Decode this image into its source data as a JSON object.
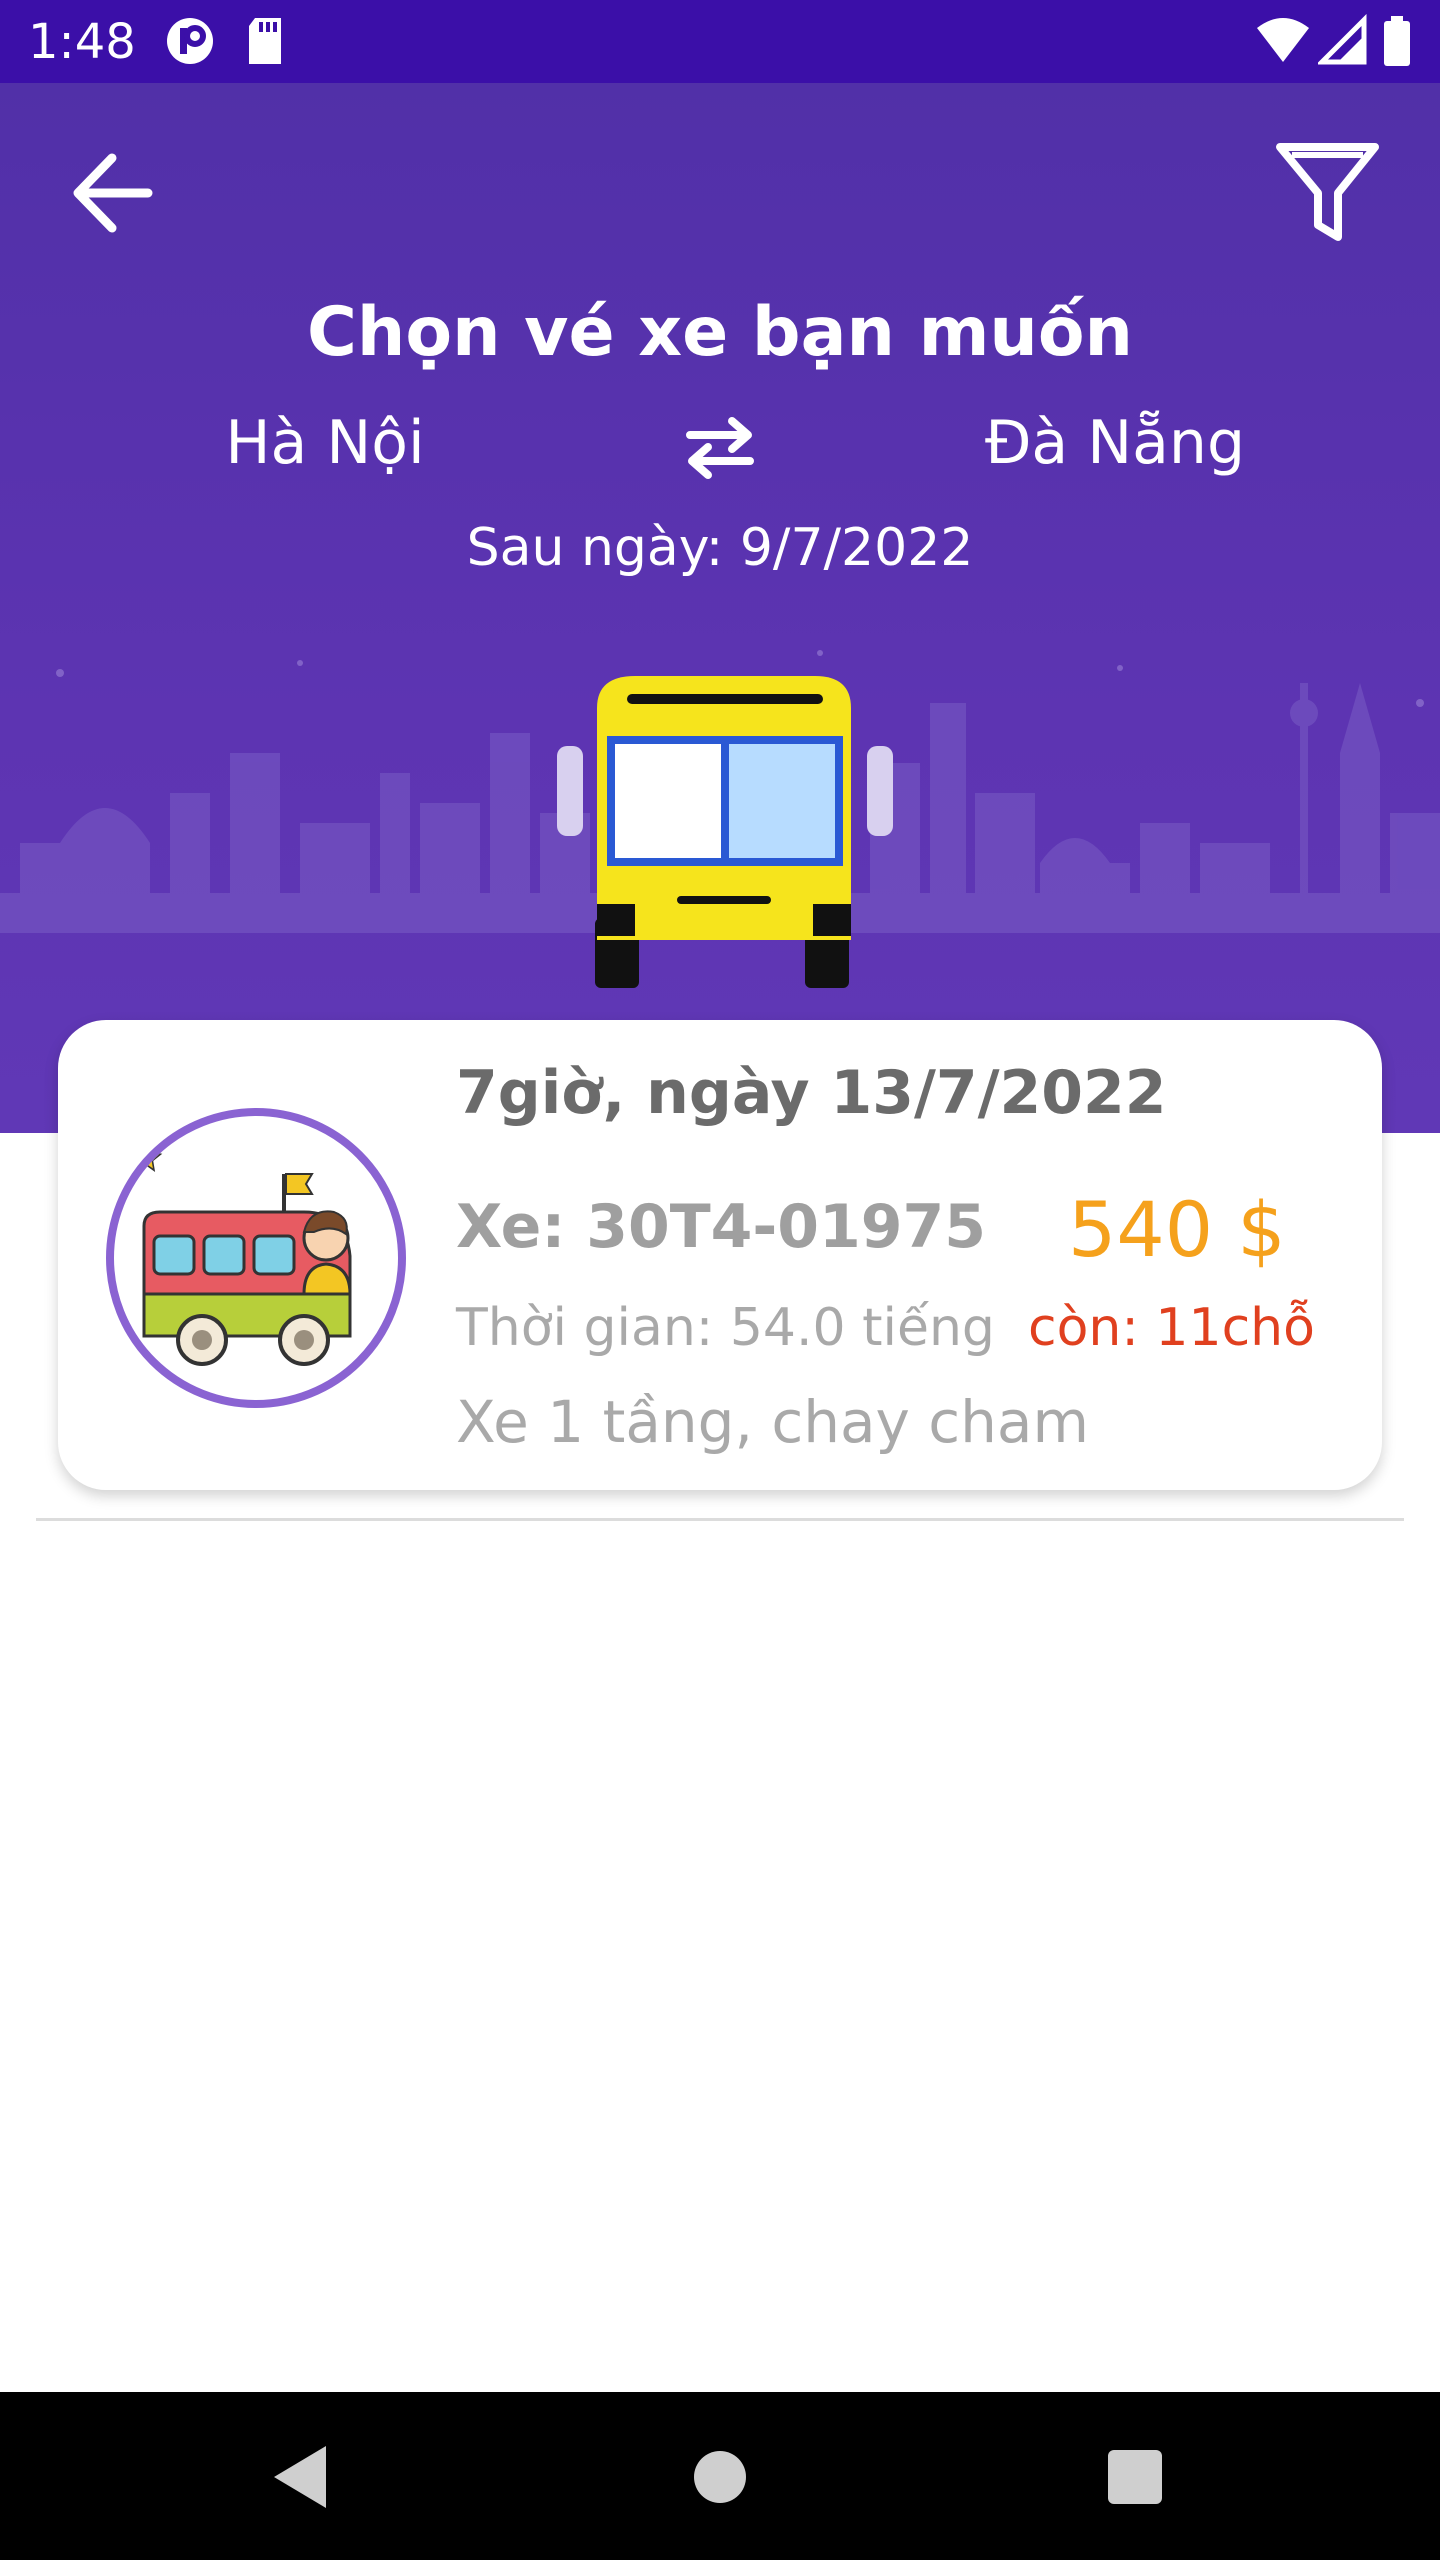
{
  "status_bar": {
    "time": "1:48"
  },
  "header": {
    "title": "Chọn vé xe bạn muốn",
    "from_city": "Hà Nội",
    "to_city": "Đà Nẵng",
    "date_line": "Sau ngày: 9/7/2022",
    "icons": [
      "back-arrow-icon",
      "filter-icon",
      "swap-icon"
    ],
    "colors": {
      "header": "#5730aa",
      "status_bar": "#3b0fa8"
    }
  },
  "trips": [
    {
      "departure": "7giờ, ngày 13/7/2022",
      "plate": "Xe: 30T4-01975",
      "price": "540 $",
      "duration": "Thời gian: 54.0 tiếng",
      "seats": "còn: 11chỗ",
      "description": "Xe 1 tầng, chay cham"
    }
  ],
  "colors": {
    "price": "#f5a11c",
    "seats": "#e0401f",
    "avatar_ring": "#8a63d2"
  }
}
